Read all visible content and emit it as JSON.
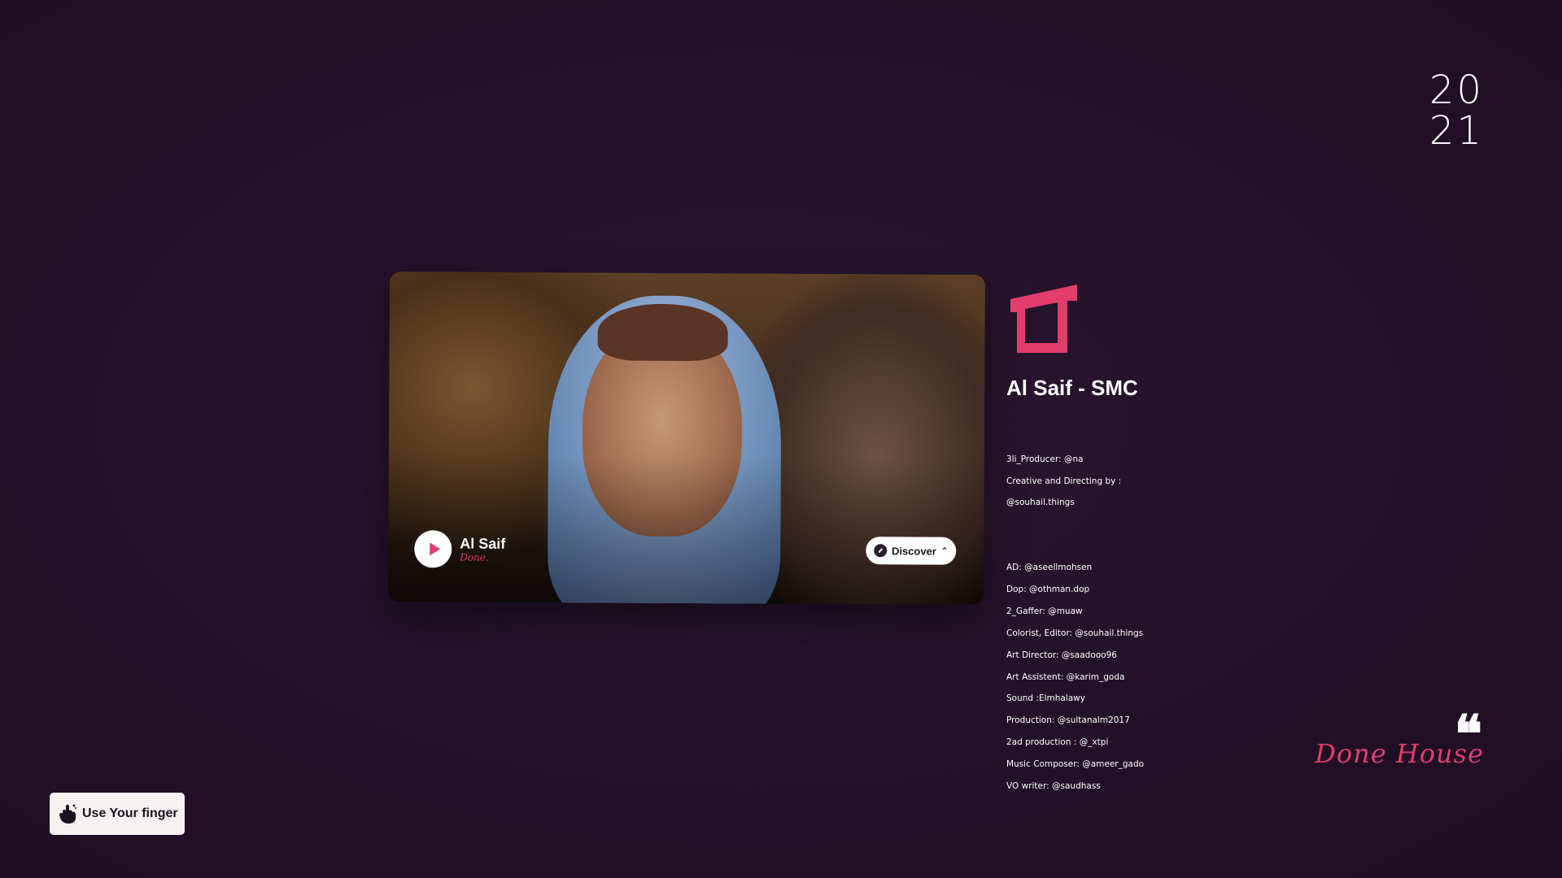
{
  "year": {
    "line1": "20",
    "line2": "21"
  },
  "video_card": {
    "title": "Al Saif",
    "subtitle": "Done.",
    "discover_label": "Discover",
    "discover_chevron": "⌃"
  },
  "project": {
    "logo_icon": "done-logo-icon",
    "title": "Al Saif - SMC",
    "credits_group1": [
      "3li_Producer: @na",
      "Creative and Directing by :",
      "@souhail.things"
    ],
    "credits_group2": [
      "AD: @aseellmohsen",
      "Dop: @othman.dop",
      "2_Gaffer: @muaw",
      "Colorist, Editor: @souhail.things",
      "Art Director: @saadooo96",
      "Art Assistent: @karim_goda",
      "Sound :Elmhalawy",
      "Production: @sultanalm2017",
      "2ad production : @_xtpi",
      "Music Composer: @ameer_gado",
      "VO writer: @saudhass"
    ]
  },
  "quote": {
    "mark": "❝",
    "signature": "Done House"
  },
  "hint": {
    "label": "Use Your finger",
    "icon": "hand-pointer-icon"
  },
  "colors": {
    "background": "#221026",
    "accent": "#e23d6d",
    "text": "#ffffff"
  }
}
